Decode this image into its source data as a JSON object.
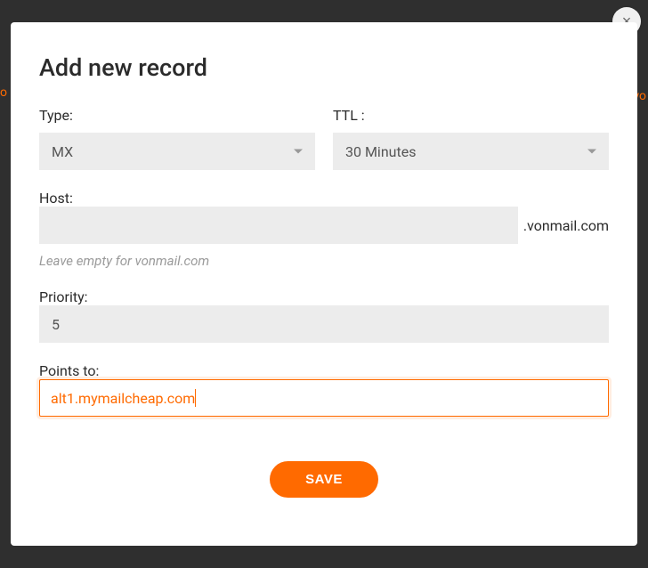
{
  "modal": {
    "title": "Add new record",
    "close_label": "×"
  },
  "fields": {
    "type": {
      "label": "Type:",
      "value": "MX"
    },
    "ttl": {
      "label": "TTL :",
      "value": "30 Minutes"
    },
    "host": {
      "label": "Host:",
      "value": "",
      "suffix": ".vonmail.com",
      "hint": "Leave empty for vonmail.com"
    },
    "priority": {
      "label": "Priority:",
      "value": "5"
    },
    "points_to": {
      "label": "Points to:",
      "value": "alt1.mymailcheap.com"
    }
  },
  "buttons": {
    "save": "SAVE"
  },
  "backdrop": {
    "hint_right": "vo",
    "hint_left": "o"
  }
}
